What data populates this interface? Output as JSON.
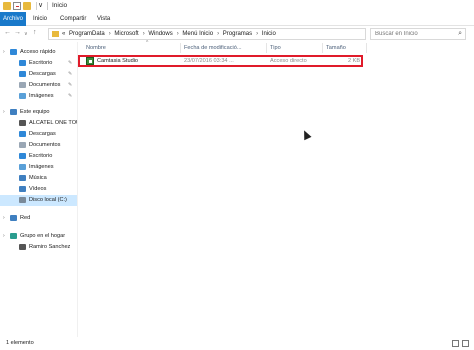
{
  "window": {
    "title": "Inicio"
  },
  "ribbon": {
    "tabs": [
      "Archivo",
      "Inicio",
      "Compartir",
      "Vista"
    ]
  },
  "address_bar": {
    "crumbs": [
      "«",
      "ProgramData",
      "Microsoft",
      "Windows",
      "Menú Inicio",
      "Programas",
      "Inicio"
    ],
    "search_placeholder": "Buscar en Inicio"
  },
  "sidebar": {
    "items": [
      {
        "label": "Acceso rápido",
        "icon": "star-icon",
        "color": "#2f88d8",
        "level": 0,
        "chevron": true
      },
      {
        "label": "Escritorio",
        "icon": "desktop-icon",
        "color": "#2f88d8",
        "level": 1,
        "pinned": true
      },
      {
        "label": "Descargas",
        "icon": "download-icon",
        "color": "#2f88d8",
        "level": 1,
        "pinned": true
      },
      {
        "label": "Documentos",
        "icon": "documents-icon",
        "color": "#9aa7b5",
        "level": 1,
        "pinned": true
      },
      {
        "label": "Imágenes",
        "icon": "pictures-icon",
        "color": "#5aa0d8",
        "level": 1,
        "pinned": true
      },
      {
        "label": "Este equipo",
        "icon": "computer-icon",
        "color": "#3f7fc0",
        "level": 0,
        "chevron": true
      },
      {
        "label": "ALCATEL ONE TOU",
        "icon": "device-icon",
        "color": "#555555",
        "level": 1
      },
      {
        "label": "Descargas",
        "icon": "download-icon",
        "color": "#2f88d8",
        "level": 1
      },
      {
        "label": "Documentos",
        "icon": "documents-icon",
        "color": "#9aa7b5",
        "level": 1
      },
      {
        "label": "Escritorio",
        "icon": "desktop-icon",
        "color": "#2f88d8",
        "level": 1
      },
      {
        "label": "Imágenes",
        "icon": "pictures-icon",
        "color": "#5aa0d8",
        "level": 1
      },
      {
        "label": "Música",
        "icon": "music-icon",
        "color": "#3f7fc0",
        "level": 1
      },
      {
        "label": "Vídeos",
        "icon": "videos-icon",
        "color": "#3f7fc0",
        "level": 1
      },
      {
        "label": "Disco local (C:)",
        "icon": "drive-icon",
        "color": "#7a8a99",
        "level": 1,
        "selected": true
      },
      {
        "label": "Red",
        "icon": "network-icon",
        "color": "#3f7fc0",
        "level": 0,
        "chevron": true
      },
      {
        "label": "Grupo en el hogar",
        "icon": "homegroup-icon",
        "color": "#2a9d8f",
        "level": 0,
        "chevron": true
      },
      {
        "label": "Ramiro Sanchez",
        "icon": "user-icon",
        "color": "#555555",
        "level": 1
      }
    ]
  },
  "columns": {
    "name": "Nombre",
    "date": "Fecha de modificació...",
    "type": "Tipo",
    "size": "Tamaño"
  },
  "files": [
    {
      "name": "Camtasia Studio",
      "date": "23/07/2016 03:34 ...",
      "type": "Acceso directo",
      "size": "2 KB",
      "icon": "shortcut-icon"
    }
  ],
  "status": {
    "count": "1 elemento"
  },
  "colors": {
    "accent": "#1979ca",
    "highlight": "#e01b2a",
    "selection": "#cce8ff"
  }
}
